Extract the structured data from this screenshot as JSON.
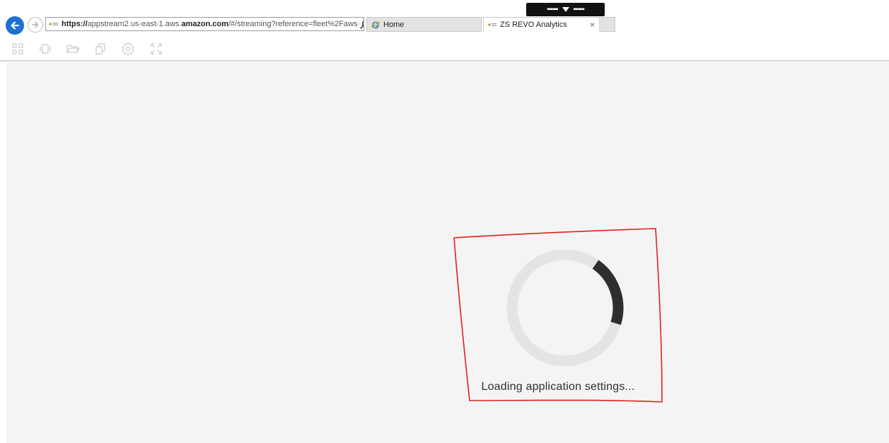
{
  "browser": {
    "address": {
      "protocol": "https://",
      "host_prefix": "appstream2.us-east-1.aws.",
      "host_domain": "amazon.com",
      "path": "/#/streaming?reference=fleet%2Faws·"
    },
    "tabs": [
      {
        "label": "Home",
        "active": false
      },
      {
        "label": "ZS REVO Analytics",
        "active": true
      }
    ],
    "close_glyph": "×"
  },
  "floating_bar": {
    "left_dots": "▪▪▪▪▪▪",
    "right_dots": "▪▪▪▪▪▪"
  },
  "toolbar_icons": [
    "apps-grid-icon",
    "windows-icon",
    "folder-icon",
    "clipboard-icon",
    "settings-icon",
    "fullscreen-icon"
  ],
  "loading": {
    "message": "Loading application settings...",
    "progress": 0.2
  },
  "colors": {
    "accent_blue": "#1d6fd3",
    "annotation_red": "#e0211d",
    "spinner_track": "#e4e4e4",
    "spinner_arc": "#2e2e2e",
    "content_bg": "#f4f4f4"
  }
}
